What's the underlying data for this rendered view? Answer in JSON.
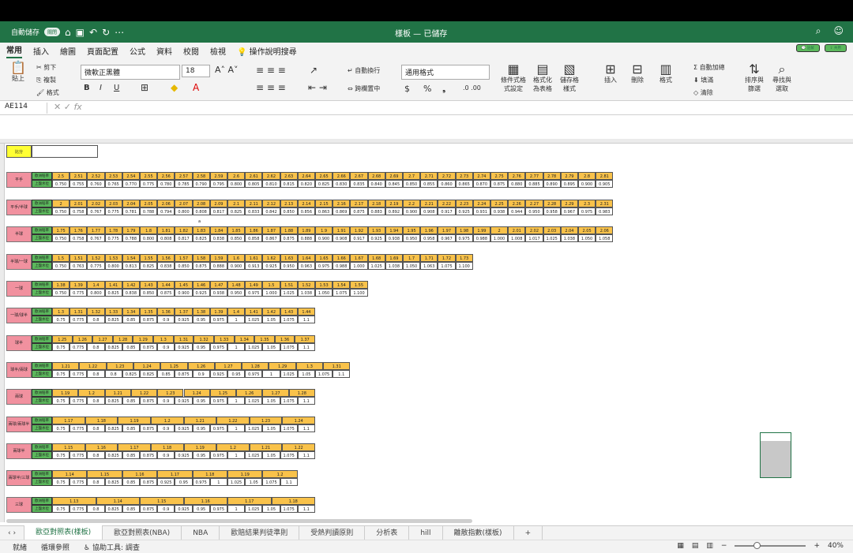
{
  "window": {
    "autosave_label": "自動儲存",
    "autosave_state": "關閉",
    "title": "樣板 — 已儲存"
  },
  "menu": {
    "tabs": [
      "常用",
      "插入",
      "繪圖",
      "頁面配置",
      "公式",
      "資料",
      "校閱",
      "檢視"
    ],
    "tellme": "操作說明搜尋",
    "comments": "註解",
    "share": "共用"
  },
  "ribbon": {
    "paste": "貼上",
    "cut": "剪下",
    "copy": "複製",
    "format_painter": "格式",
    "font_name": "微軟正黑體",
    "font_size": "18",
    "wrap_text": "自動換行",
    "merge_center": "跨欄置中",
    "number_format": "通用格式",
    "cond_format": "條件式格式設定",
    "format_table": "格式化為表格",
    "cell_styles": "儲存格樣式",
    "insert": "插入",
    "delete": "刪除",
    "format": "格式",
    "autosum": "自動加總",
    "fill": "填滿",
    "clear": "清除",
    "sort_filter": "排序與篩選",
    "find_select": "尋找與選取",
    "bold": "B",
    "italic": "I",
    "underline": "U",
    "percent": "%",
    "currency": "$"
  },
  "formula_bar": {
    "name_box": "AE114",
    "fx": "fx"
  },
  "sheet": {
    "top_label": "比分",
    "row_a": "歐洲賠率",
    "row_b": "上盤水位",
    "marker_a": "a",
    "blocks": [
      {
        "name": "平手",
        "odds": [
          "2.5",
          "2.51",
          "2.52",
          "2.53",
          "2.54",
          "2.55",
          "2.56",
          "2.57",
          "2.58",
          "2.59",
          "2.6",
          "2.61",
          "2.62",
          "2.63",
          "2.64",
          "2.65",
          "2.66",
          "2.67",
          "2.68",
          "2.69",
          "2.7",
          "2.71",
          "2.72",
          "2.73",
          "2.74",
          "2.75",
          "2.76",
          "2.77",
          "2.78",
          "2.79",
          "2.8",
          "2.81"
        ],
        "water": [
          "0.750",
          "0.755",
          "0.760",
          "0.765",
          "0.770",
          "0.775",
          "0.780",
          "0.785",
          "0.790",
          "0.795",
          "0.800",
          "0.805",
          "0.810",
          "0.815",
          "0.820",
          "0.825",
          "0.830",
          "0.835",
          "0.840",
          "0.845",
          "0.850",
          "0.855",
          "0.860",
          "0.865",
          "0.870",
          "0.875",
          "0.880",
          "0.885",
          "0.890",
          "0.895",
          "0.900",
          "0.905"
        ]
      },
      {
        "name": "平手/半球",
        "odds": [
          "2",
          "2.01",
          "2.02",
          "2.03",
          "2.04",
          "2.05",
          "2.06",
          "2.07",
          "2.08",
          "2.09",
          "2.1",
          "2.11",
          "2.12",
          "2.13",
          "2.14",
          "2.15",
          "2.16",
          "2.17",
          "2.18",
          "2.19",
          "2.2",
          "2.21",
          "2.22",
          "2.23",
          "2.24",
          "2.25",
          "2.26",
          "2.27",
          "2.28",
          "2.29",
          "2.3",
          "2.31"
        ],
        "water": [
          "0.750",
          "0.758",
          "0.767",
          "0.775",
          "0.781",
          "0.788",
          "0.794",
          "0.800",
          "0.808",
          "0.817",
          "0.825",
          "0.833",
          "0.842",
          "0.850",
          "0.856",
          "0.863",
          "0.869",
          "0.875",
          "0.883",
          "0.892",
          "0.900",
          "0.908",
          "0.917",
          "0.925",
          "0.931",
          "0.938",
          "0.944",
          "0.950",
          "0.958",
          "0.967",
          "0.975",
          "0.983"
        ]
      },
      {
        "name": "半球",
        "odds": [
          "1.75",
          "1.76",
          "1.77",
          "1.78",
          "1.79",
          "1.8",
          "1.81",
          "1.82",
          "1.83",
          "1.84",
          "1.85",
          "1.86",
          "1.87",
          "1.88",
          "1.89",
          "1.9",
          "1.91",
          "1.92",
          "1.93",
          "1.94",
          "1.95",
          "1.96",
          "1.97",
          "1.98",
          "1.99",
          "2",
          "2.01",
          "2.02",
          "2.03",
          "2.04",
          "2.05",
          "2.06"
        ],
        "water": [
          "0.750",
          "0.758",
          "0.767",
          "0.775",
          "0.788",
          "0.800",
          "0.808",
          "0.817",
          "0.825",
          "0.838",
          "0.850",
          "0.858",
          "0.867",
          "0.875",
          "0.888",
          "0.900",
          "0.908",
          "0.917",
          "0.925",
          "0.938",
          "0.950",
          "0.958",
          "0.967",
          "0.975",
          "0.988",
          "1.000",
          "1.008",
          "1.017",
          "1.025",
          "1.038",
          "1.050",
          "1.058"
        ]
      },
      {
        "name": "半球/一球",
        "odds": [
          "1.5",
          "1.51",
          "1.52",
          "1.53",
          "1.54",
          "1.55",
          "1.56",
          "1.57",
          "1.58",
          "1.59",
          "1.6",
          "1.61",
          "1.62",
          "1.63",
          "1.64",
          "1.65",
          "1.66",
          "1.67",
          "1.68",
          "1.69",
          "1.7",
          "1.71",
          "1.72",
          "1.73"
        ],
        "water": [
          "0.750",
          "0.763",
          "0.775",
          "0.800",
          "0.813",
          "0.825",
          "0.838",
          "0.850",
          "0.875",
          "0.888",
          "0.900",
          "0.913",
          "0.925",
          "0.950",
          "0.963",
          "0.975",
          "0.988",
          "1.000",
          "1.025",
          "1.038",
          "1.050",
          "1.063",
          "1.075",
          "1.100"
        ]
      },
      {
        "name": "一球",
        "odds": [
          "1.38",
          "1.39",
          "1.4",
          "1.41",
          "1.42",
          "1.43",
          "1.44",
          "1.45",
          "1.46",
          "1.47",
          "1.48",
          "1.49",
          "1.5",
          "1.51",
          "1.52",
          "1.53",
          "1.54",
          "1.55"
        ],
        "water": [
          "0.750",
          "0.775",
          "0.800",
          "0.825",
          "0.838",
          "0.850",
          "0.875",
          "0.900",
          "0.925",
          "0.938",
          "0.950",
          "0.975",
          "1.000",
          "1.025",
          "1.038",
          "1.050",
          "1.075",
          "1.100"
        ]
      },
      {
        "name": "一球/球半",
        "odds": [
          "1.3",
          "1.31",
          "1.32",
          "1.33",
          "1.34",
          "1.35",
          "1.36",
          "1.37",
          "1.38",
          "1.39",
          "1.4",
          "1.41",
          "1.42",
          "1.43",
          "1.44"
        ],
        "water": [
          "0.75",
          "0.775",
          "0.8",
          "0.825",
          "0.85",
          "0.875",
          "0.9",
          "0.925",
          "0.95",
          "0.975",
          "1",
          "1.025",
          "1.05",
          "1.075",
          "1.1"
        ]
      },
      {
        "name": "球半",
        "odds": [
          "1.25",
          "1.26",
          "1.27",
          "1.28",
          "1.29",
          "1.3",
          "1.31",
          "1.32",
          "1.33",
          "1.34",
          "1.35",
          "1.36",
          "1.37"
        ],
        "water": [
          "0.75",
          "0.775",
          "0.8",
          "0.825",
          "0.85",
          "0.875",
          "0.9",
          "0.925",
          "0.95",
          "0.975",
          "1",
          "1.025",
          "1.05",
          "1.075",
          "1.1"
        ]
      },
      {
        "name": "球半/兩球",
        "odds": [
          "1.21",
          "1.22",
          "1.23",
          "1.24",
          "1.25",
          "1.26",
          "1.27",
          "1.28",
          "1.29",
          "1.3",
          "1.31"
        ],
        "water": [
          "0.75",
          "0.775",
          "0.8",
          "0.8",
          "0.825",
          "0.825",
          "0.85",
          "0.875",
          "0.9",
          "0.925",
          "0.95",
          "0.975",
          "1",
          "1.025",
          "1.05",
          "1.075",
          "1.1"
        ]
      },
      {
        "name": "兩球",
        "odds": [
          "1.19",
          "1.2",
          "1.21",
          "1.22",
          "1.23",
          "1.24",
          "1.25",
          "1.26",
          "1.27",
          "1.28"
        ],
        "water": [
          "0.75",
          "0.775",
          "0.8",
          "0.825",
          "0.85",
          "0.875",
          "0.9",
          "0.925",
          "0.95",
          "0.975",
          "1",
          "1.025",
          "1.05",
          "1.075",
          "1.1"
        ]
      },
      {
        "name": "兩球/兩球半",
        "odds": [
          "1.17",
          "1.18",
          "1.19",
          "1.2",
          "1.21",
          "1.22",
          "1.23",
          "1.24"
        ],
        "water": [
          "0.75",
          "0.775",
          "0.8",
          "0.825",
          "0.85",
          "0.875",
          "0.9",
          "0.925",
          "0.95",
          "0.975",
          "1",
          "1.025",
          "1.05",
          "1.075",
          "1.1"
        ]
      },
      {
        "name": "兩球半",
        "odds": [
          "1.15",
          "1.16",
          "1.17",
          "1.18",
          "1.19",
          "1.2",
          "1.21",
          "1.22"
        ],
        "water": [
          "0.75",
          "0.775",
          "0.8",
          "0.825",
          "0.85",
          "0.875",
          "0.9",
          "0.925",
          "0.95",
          "0.975",
          "1",
          "1.025",
          "1.05",
          "1.075",
          "1.1"
        ]
      },
      {
        "name": "兩球半/三球",
        "odds": [
          "1.14",
          "1.15",
          "1.16",
          "1.17",
          "1.18",
          "1.19",
          "1.2"
        ],
        "water": [
          "0.75",
          "0.775",
          "0.8",
          "0.825",
          "0.85",
          "0.875",
          "0.925",
          "0.95",
          "0.975",
          "1",
          "1.025",
          "1.05",
          "1.075",
          "1.1"
        ]
      },
      {
        "name": "三球",
        "odds": [
          "1.13",
          "1.14",
          "1.15",
          "1.16",
          "1.17",
          "1.18"
        ],
        "water": [
          "0.75",
          "0.775",
          "0.8",
          "0.825",
          "0.85",
          "0.875",
          "0.9",
          "0.925",
          "0.95",
          "0.975",
          "1",
          "1.025",
          "1.05",
          "1.075",
          "1.1"
        ]
      }
    ]
  },
  "sheet_tabs": [
    "歐亞對照表(樣板)",
    "歐亞對照表(NBA)",
    "NBA",
    "歐賠結果判徒準則",
    "受熱判讀原則",
    "分析表",
    "hill",
    "離散指數(樣板)"
  ],
  "status": {
    "ready": "就緒",
    "circular": "循環參照",
    "accessibility": "協助工具: 調查",
    "zoom": "40%"
  },
  "colors": {
    "excel_green": "#217346",
    "cell_yellow": "#f9c24a",
    "cell_pink": "#f1919f",
    "cell_green": "#5bb85c"
  }
}
